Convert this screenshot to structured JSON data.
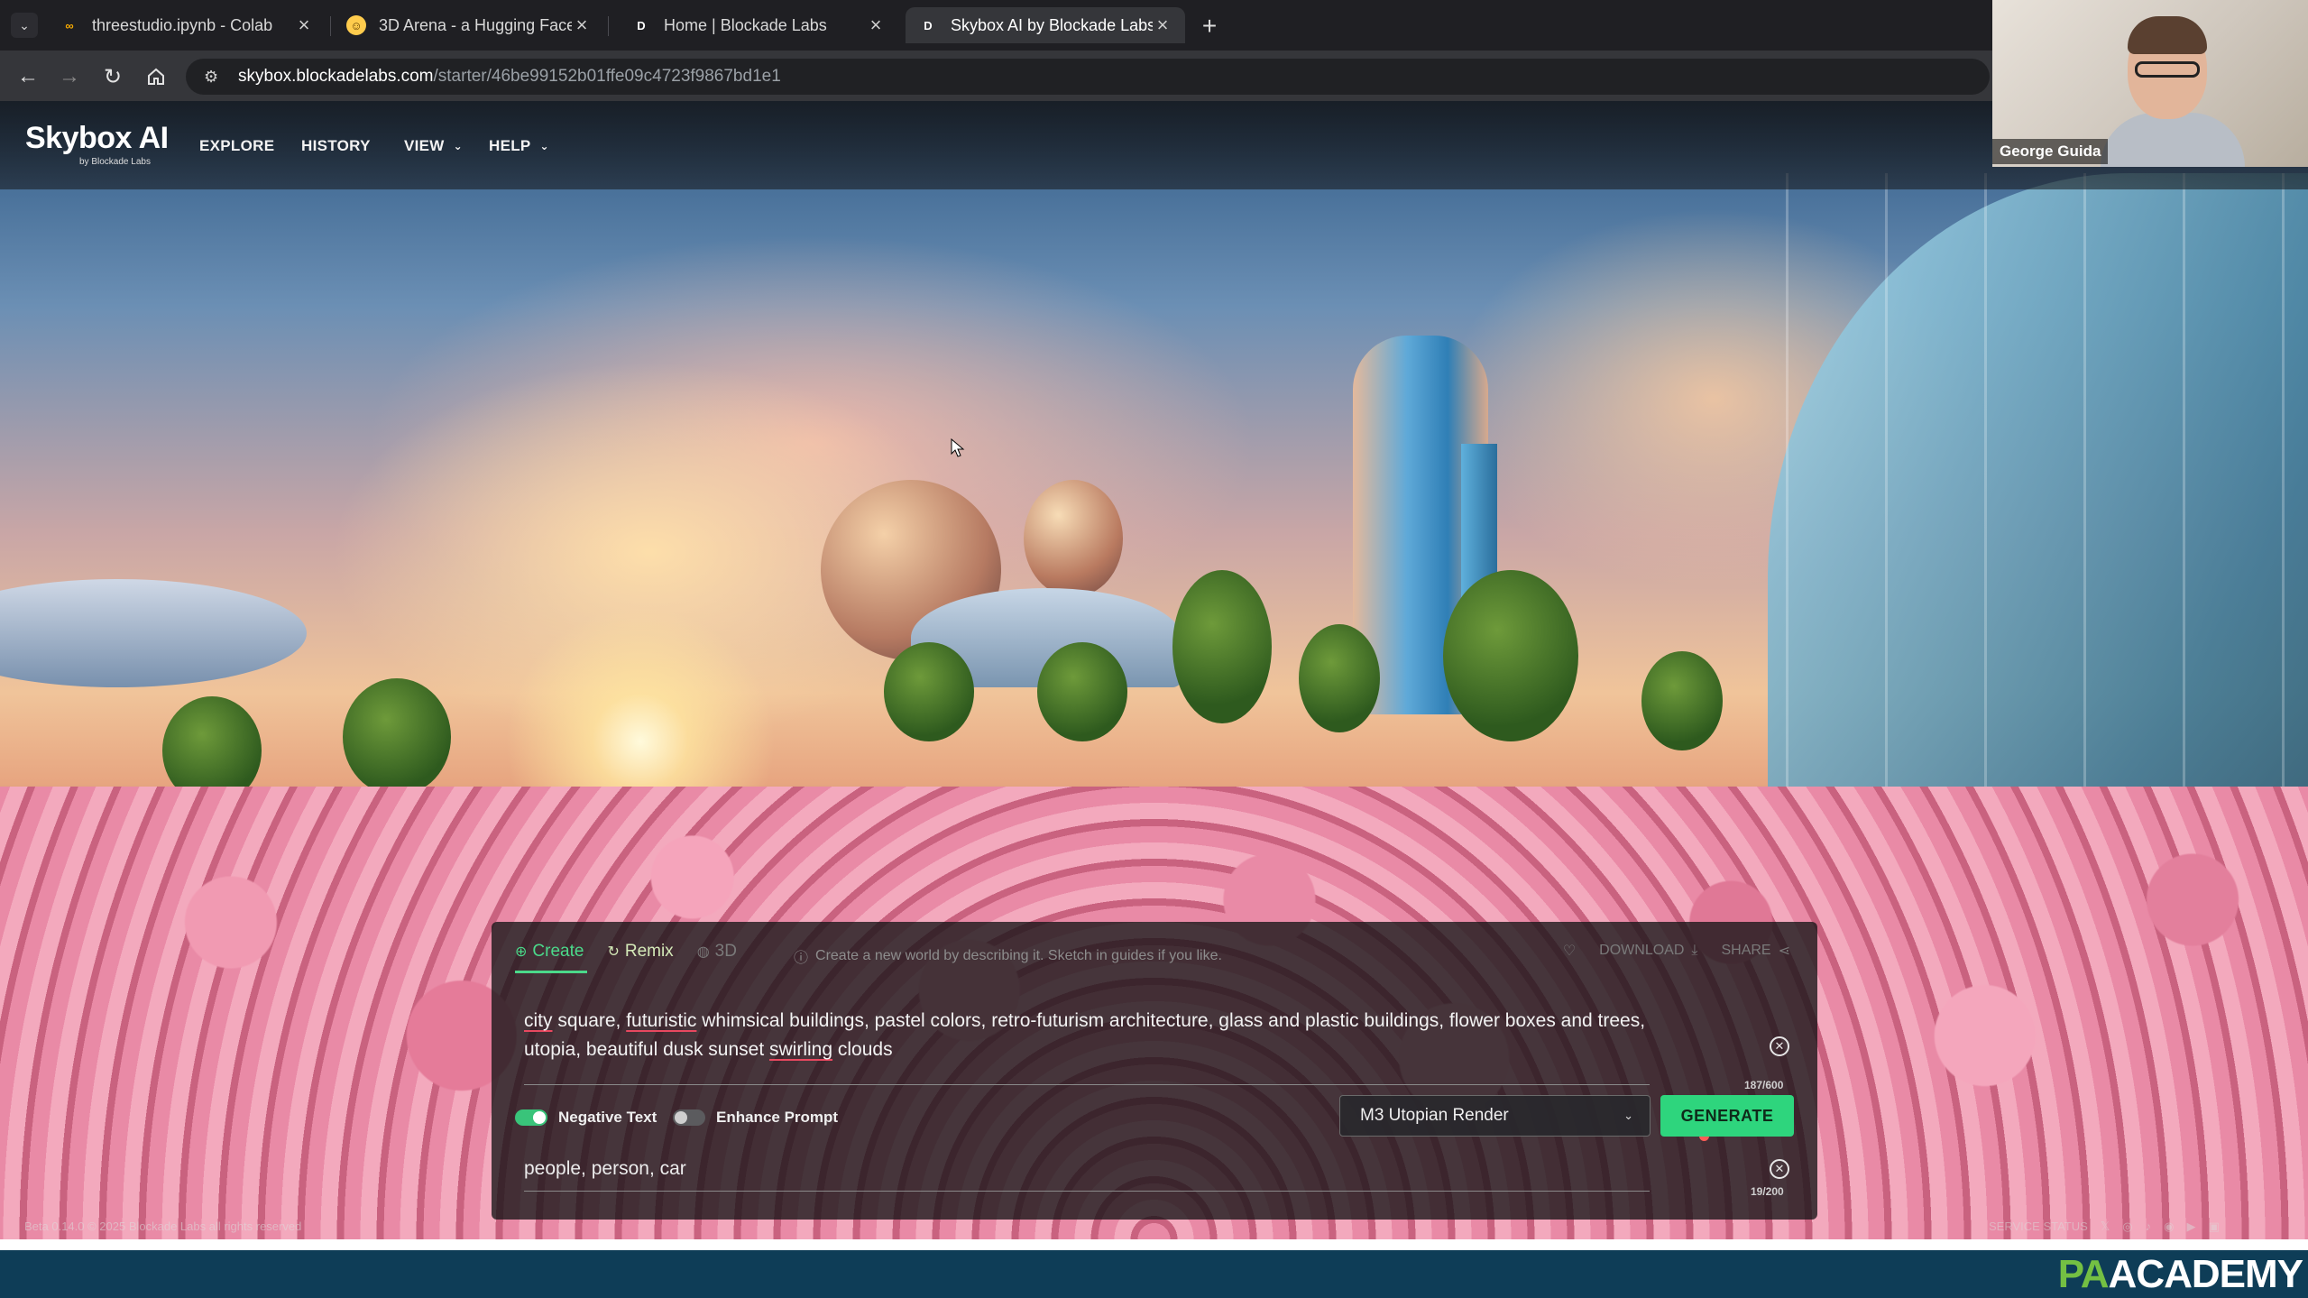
{
  "browser": {
    "tabs": [
      {
        "title": "threestudio.ipynb - Colab",
        "favicon": "colab-icon",
        "active": false
      },
      {
        "title": "3D Arena - a Hugging Face Sp",
        "favicon": "hugging-face-icon",
        "active": false
      },
      {
        "title": "Home | Blockade Labs",
        "favicon": "blockade-icon",
        "active": false
      },
      {
        "title": "Skybox AI by Blockade Labs",
        "favicon": "blockade-icon",
        "active": true
      }
    ],
    "url_host": "skybox.blockadelabs.com",
    "url_path": "/starter/46be99152b01ffe09c4723f9867bd1e1"
  },
  "site": {
    "logo": "Skybox AI",
    "logo_sub": "by Blockade Labs",
    "nav": [
      "EXPLORE",
      "HISTORY",
      "VIEW",
      "HELP"
    ]
  },
  "video_overlay": {
    "name": "George Guida"
  },
  "panel": {
    "tabs": [
      "Create",
      "Remix",
      "3D"
    ],
    "hint": "Create a new world by describing it. Sketch in guides if you like.",
    "actions": [
      "DOWNLOAD",
      "SHARE"
    ],
    "prompt_parts": [
      {
        "text": "city",
        "underline": true
      },
      {
        "text": " square, ",
        "underline": false
      },
      {
        "text": "futuristic",
        "underline": true
      },
      {
        "text": " whimsical buildings, pastel colors, retro-futurism architecture, glass and plastic buildings, flower boxes and trees, utopia, beautiful dusk sunset ",
        "underline": false
      },
      {
        "text": "swirling",
        "underline": true
      },
      {
        "text": " clouds",
        "underline": false
      }
    ],
    "prompt_counter": "187/600",
    "negative_toggle": "Negative Text",
    "enhance_toggle": "Enhance Prompt",
    "model": "M3 Utopian Render",
    "generate": "GENERATE",
    "negative_text": "people, person, car",
    "negative_counter": "19/200"
  },
  "footer": {
    "left": "Beta 0.14.0   © 2025 Blockade Labs all rights reserved",
    "right": "SERVICE STATUS"
  },
  "brand": {
    "pa": "PA",
    "academy": "ACADEMY"
  },
  "colors": {
    "accent": "#2ed57d",
    "brand_green": "#74c043",
    "brand_band": "#0e3d57"
  }
}
